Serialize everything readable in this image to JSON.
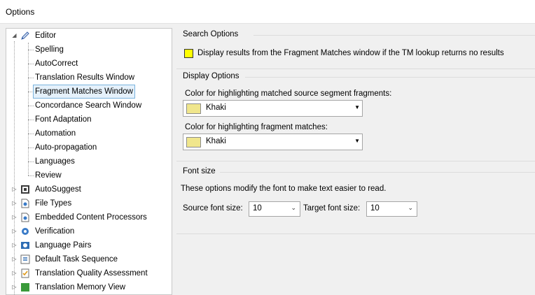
{
  "window": {
    "title": "Options"
  },
  "tree": {
    "editor": {
      "label": "Editor",
      "children": [
        "Spelling",
        "AutoCorrect",
        "Translation Results Window",
        "Fragment Matches Window",
        "Concordance Search Window",
        "Font Adaptation",
        "Automation",
        "Auto-propagation",
        "Languages",
        "Review"
      ]
    },
    "others": [
      "AutoSuggest",
      "File Types",
      "Embedded Content Processors",
      "Verification",
      "Language Pairs",
      "Default Task Sequence",
      "Translation Quality Assessment",
      "Translation Memory View"
    ]
  },
  "search_options": {
    "title": "Search Options",
    "checkbox_label": "Display results from the Fragment Matches window if the TM lookup returns no results"
  },
  "display_options": {
    "title": "Display Options",
    "source_label": "Color for highlighting matched source segment fragments:",
    "source_value": "Khaki",
    "fragment_label": "Color for highlighting fragment matches:",
    "fragment_value": "Khaki",
    "swatch_color": "#f0e68c"
  },
  "font_size": {
    "title": "Font size",
    "description": "These options modify the font to make text easier to read.",
    "source_label": "Source font size:",
    "source_value": "10",
    "target_label": "Target font size:",
    "target_value": "10"
  }
}
